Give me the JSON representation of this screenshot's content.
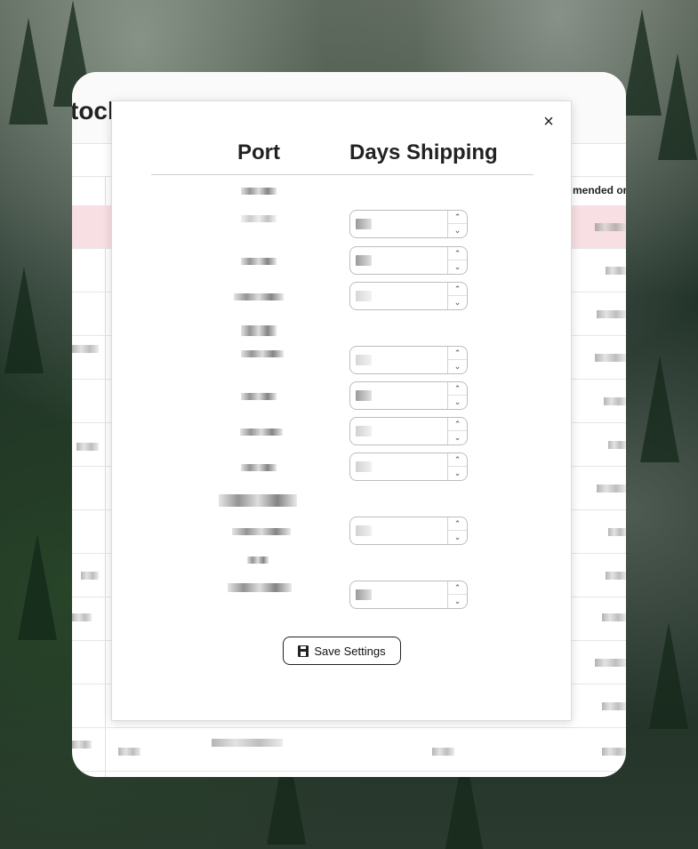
{
  "app": {
    "title_fragment": "tock",
    "column_header_fragment": "mended or"
  },
  "modal": {
    "close_label": "×",
    "headers": {
      "port": "Port",
      "days": "Days Shipping"
    },
    "save_label": "Save Settings",
    "rows": [
      {
        "has_input": false
      },
      {
        "has_input": true
      },
      {
        "has_input": true
      },
      {
        "has_input": true
      },
      {
        "has_input": false
      },
      {
        "has_input": true
      },
      {
        "has_input": true
      },
      {
        "has_input": true
      },
      {
        "has_input": true
      },
      {
        "has_input": false
      },
      {
        "has_input": true
      },
      {
        "has_input": false
      },
      {
        "has_input": true
      }
    ]
  },
  "icons": {
    "close": "close-icon",
    "save": "floppy-disk-icon",
    "spin_up": "chevron-up-icon",
    "spin_down": "chevron-down-icon"
  }
}
